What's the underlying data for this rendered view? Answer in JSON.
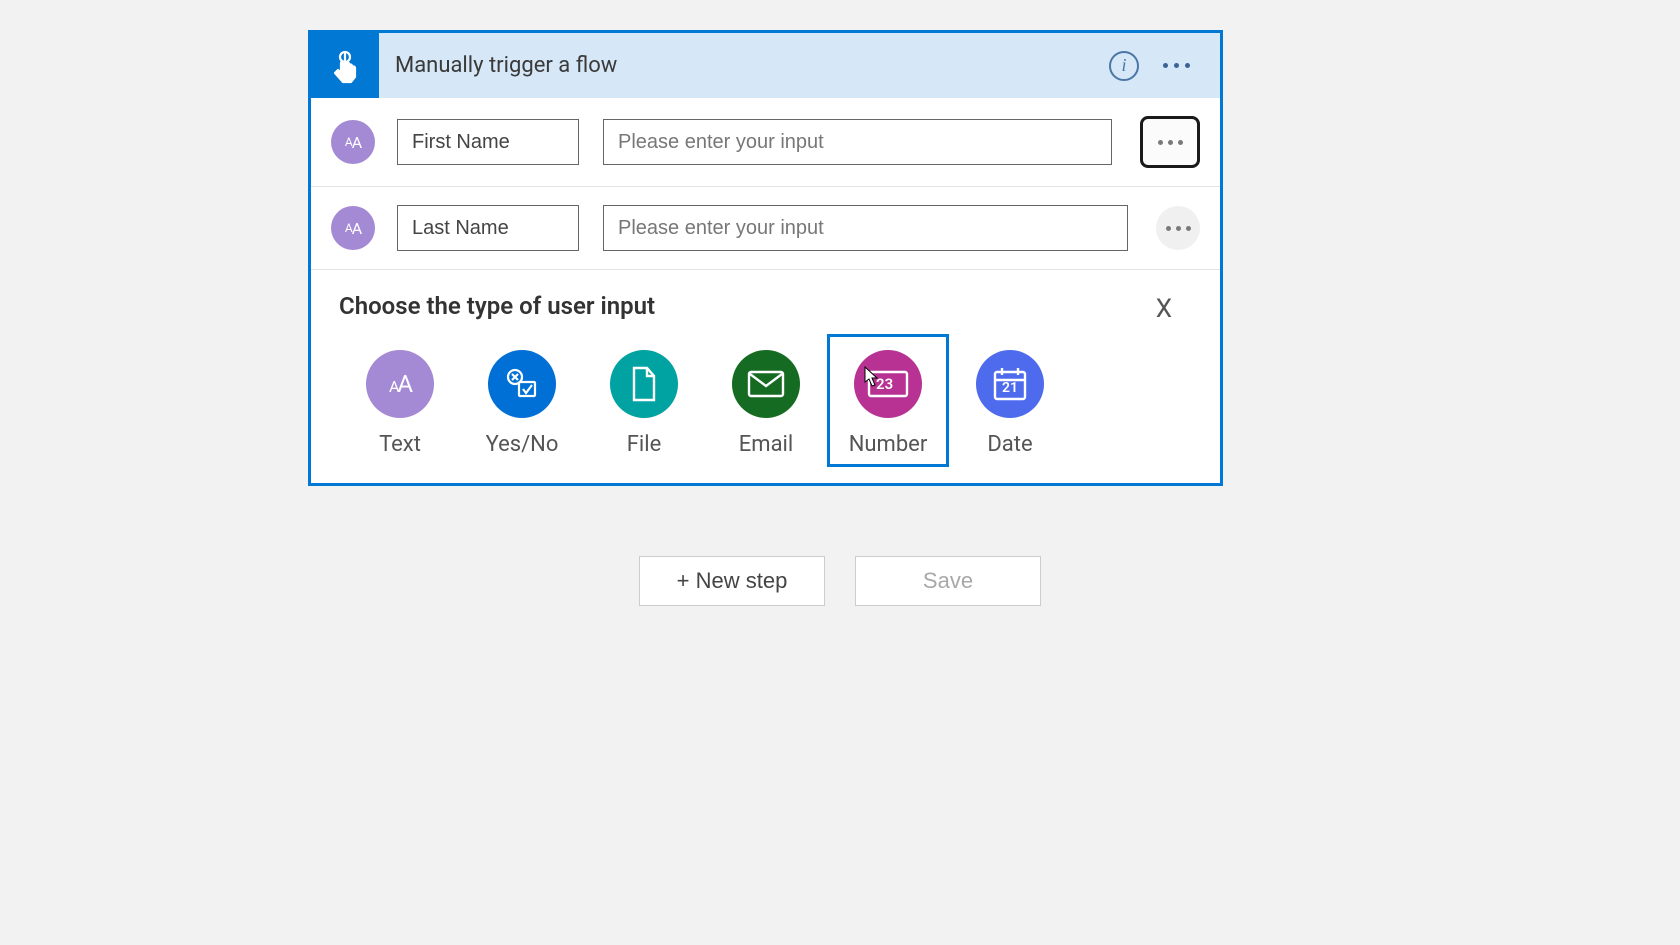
{
  "trigger": {
    "title": "Manually trigger a flow"
  },
  "inputs": [
    {
      "name": "First Name",
      "placeholder": "Please enter your input"
    },
    {
      "name": "Last Name",
      "placeholder": "Please enter your input"
    }
  ],
  "picker": {
    "title": "Choose the type of user input",
    "close": "X",
    "options": {
      "text": "Text",
      "yesno": "Yes/No",
      "file": "File",
      "email": "Email",
      "number": "Number",
      "date": "Date"
    },
    "date_day": "21",
    "number_box": "23"
  },
  "buttons": {
    "new_step": "+ New step",
    "save": "Save"
  },
  "colors": {
    "primary": "#0078d4",
    "header_bg": "#d6e8f7",
    "text_icon": "#a489d5",
    "yesno_icon": "#0070d6",
    "file_icon": "#00a2a2",
    "email_icon": "#166b22",
    "number_icon": "#b73292",
    "date_icon": "#4f6bed"
  }
}
